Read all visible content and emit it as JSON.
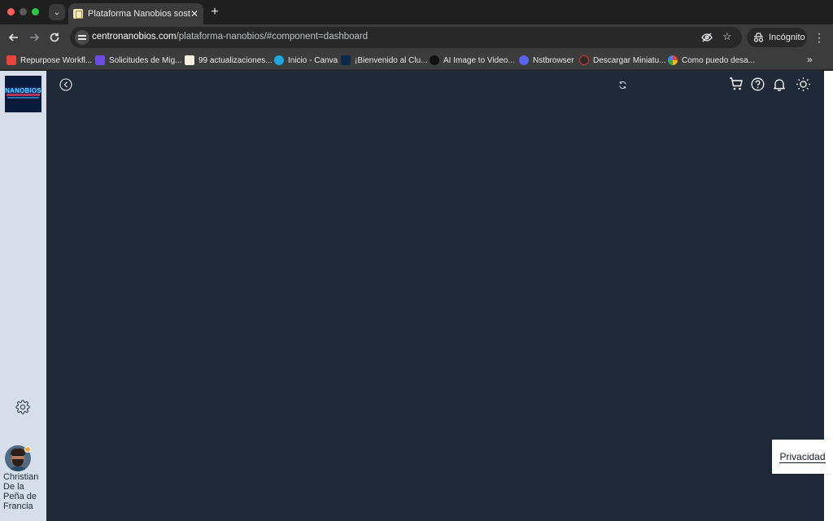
{
  "browser": {
    "tab_title": "Plataforma Nanobios sostienen",
    "url_domain": "centronanobios.com",
    "url_path": "/plataforma-nanobios/#component=dashboard",
    "incognito_label": "Incógnito"
  },
  "bookmarks": [
    {
      "label": "Repurpose Workfl...",
      "icon_color": "#e8433b"
    },
    {
      "label": "Solicitudes de Mig...",
      "icon_color": "#6b4de6"
    },
    {
      "label": "99 actualizaciones...",
      "icon_color": "#f4efe0"
    },
    {
      "label": "Inicio - Canva",
      "icon_color": "#1ea7e0"
    },
    {
      "label": "¡Bienvenido al Clu...",
      "icon_color": "#0a2a4a"
    },
    {
      "label": "AI Image to Video...",
      "icon_color": "#111111"
    },
    {
      "label": "Nstbrowser",
      "icon_color": "#5a62f0"
    },
    {
      "label": "Descargar Miniatu...",
      "icon_color": "#2b2b2b"
    },
    {
      "label": "Como puedo desa...",
      "icon_color": "#ffffff"
    }
  ],
  "sidebar": {
    "logo_text": "NANOBIOS",
    "user_name": "Christian De la Peña de Francia",
    "settings_icon": "gear-icon"
  },
  "header": {
    "icons": [
      "chevron-left-icon",
      "refresh-icon",
      "cart-icon",
      "help-icon",
      "bell-icon",
      "sun-icon"
    ]
  },
  "privacy_label": "Privacidad",
  "colors": {
    "main_bg": "#1f2937",
    "sidebar_bg": "#d5dee9"
  }
}
